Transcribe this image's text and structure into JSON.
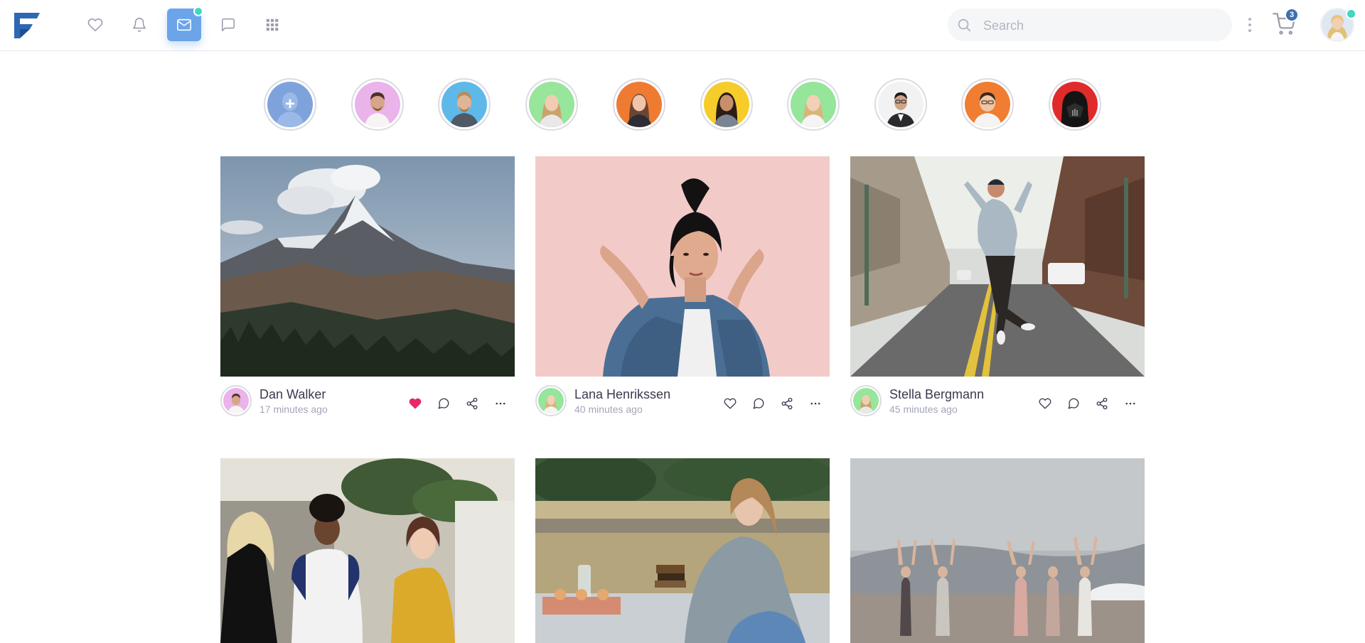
{
  "app": {
    "logo_letter": "F"
  },
  "nav": {
    "items": [
      {
        "icon": "heart-icon"
      },
      {
        "icon": "bell-icon"
      },
      {
        "icon": "mail-icon",
        "active": true
      },
      {
        "icon": "chat-icon"
      },
      {
        "icon": "grid-icon"
      }
    ]
  },
  "search": {
    "placeholder": "Search",
    "value": ""
  },
  "cart": {
    "count": "3"
  },
  "colors": {
    "accent": "#6ba4e9",
    "online": "#41d6c3",
    "badge": "#3d70b2",
    "liked": "#e62965",
    "text": "#393a4f",
    "muted": "#a2a5b9"
  },
  "stories": [
    {
      "kind": "add",
      "icon": "plus-icon"
    },
    {
      "kind": "user"
    },
    {
      "kind": "user"
    },
    {
      "kind": "user"
    },
    {
      "kind": "user"
    },
    {
      "kind": "user"
    },
    {
      "kind": "user"
    },
    {
      "kind": "user"
    },
    {
      "kind": "user"
    },
    {
      "kind": "user"
    }
  ],
  "posts": [
    {
      "author": "Dan Walker",
      "time": "17 minutes ago",
      "liked": true
    },
    {
      "author": "Lana Henrikssen",
      "time": "40 minutes ago",
      "liked": false
    },
    {
      "author": "Stella Bergmann",
      "time": "45 minutes ago",
      "liked": false
    }
  ]
}
